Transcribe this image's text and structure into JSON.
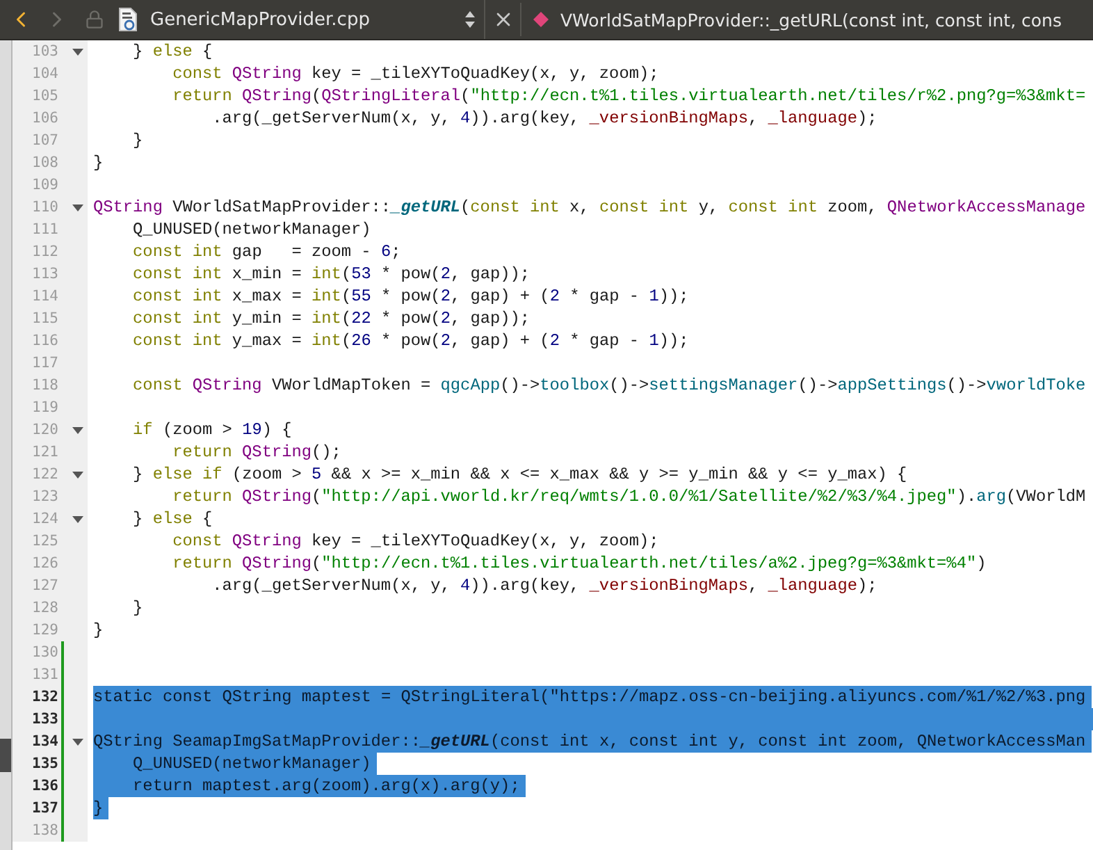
{
  "toolbar": {
    "back": {
      "disabled": false
    },
    "forward": {
      "disabled": true
    },
    "file": "GenericMapProvider.cpp",
    "symbol": "VWorldSatMapProvider::_getURL(const int, const int, cons"
  },
  "lines": [
    {
      "number": "103",
      "fold": true,
      "changed": false,
      "selected": false,
      "tokens": [
        {
          "kind": "plain",
          "text": "    } "
        },
        {
          "kind": "keyword",
          "text": "else"
        },
        {
          "kind": "plain",
          "text": " {"
        }
      ]
    },
    {
      "number": "104",
      "fold": false,
      "changed": false,
      "selected": false,
      "tokens": [
        {
          "kind": "keyword",
          "text": "        const"
        },
        {
          "kind": "type",
          "text": " QString"
        },
        {
          "kind": "plain",
          "text": " key = _tileXYToQuadKey(x, y, zoom);"
        }
      ]
    },
    {
      "number": "105",
      "fold": false,
      "changed": false,
      "selected": false,
      "tokens": [
        {
          "kind": "keyword",
          "text": "        return"
        },
        {
          "kind": "type",
          "text": " QString"
        },
        {
          "kind": "plain",
          "text": "("
        },
        {
          "kind": "type",
          "text": "QStringLiteral"
        },
        {
          "kind": "plain",
          "text": "("
        },
        {
          "kind": "string",
          "text": "\"http://ecn.t%1.tiles.virtualearth.net/tiles/r%2.png?g=%3&mkt="
        }
      ]
    },
    {
      "number": "106",
      "fold": false,
      "changed": false,
      "selected": false,
      "tokens": [
        {
          "kind": "plain",
          "text": "            .arg(_getServerNum(x, y, "
        },
        {
          "kind": "number",
          "text": "4"
        },
        {
          "kind": "plain",
          "text": ")).arg(key, "
        },
        {
          "kind": "member",
          "text": "_versionBingMaps"
        },
        {
          "kind": "plain",
          "text": ", "
        },
        {
          "kind": "member",
          "text": "_language"
        },
        {
          "kind": "plain",
          "text": ");"
        }
      ]
    },
    {
      "number": "107",
      "fold": false,
      "changed": false,
      "selected": false,
      "tokens": [
        {
          "kind": "plain",
          "text": "    }"
        }
      ]
    },
    {
      "number": "108",
      "fold": false,
      "changed": false,
      "selected": false,
      "tokens": [
        {
          "kind": "plain",
          "text": "}"
        }
      ]
    },
    {
      "number": "109",
      "fold": false,
      "changed": false,
      "selected": false
    },
    {
      "number": "110",
      "fold": true,
      "changed": false,
      "selected": false,
      "tokens": [
        {
          "kind": "type",
          "text": "QString"
        },
        {
          "kind": "plain",
          "text": " VWorldSatMapProvider::"
        },
        {
          "kind": "method",
          "text": "_getURL"
        },
        {
          "kind": "plain",
          "text": "("
        },
        {
          "kind": "keyword",
          "text": "const"
        },
        {
          "kind": "keyword",
          "text": " int"
        },
        {
          "kind": "plain",
          "text": " x, "
        },
        {
          "kind": "keyword",
          "text": "const"
        },
        {
          "kind": "keyword",
          "text": " int"
        },
        {
          "kind": "plain",
          "text": " y, "
        },
        {
          "kind": "keyword",
          "text": "const"
        },
        {
          "kind": "keyword",
          "text": " int"
        },
        {
          "kind": "plain",
          "text": " zoom, "
        },
        {
          "kind": "type",
          "text": "QNetworkAccessManage"
        }
      ]
    },
    {
      "number": "111",
      "fold": false,
      "changed": false,
      "selected": false,
      "tokens": [
        {
          "kind": "plain",
          "text": "    Q_UNUSED(networkManager)"
        }
      ]
    },
    {
      "number": "112",
      "fold": false,
      "changed": false,
      "selected": false,
      "tokens": [
        {
          "kind": "keyword",
          "text": "    const"
        },
        {
          "kind": "keyword",
          "text": " int"
        },
        {
          "kind": "plain",
          "text": " gap   = zoom - "
        },
        {
          "kind": "number",
          "text": "6"
        },
        {
          "kind": "plain",
          "text": ";"
        }
      ]
    },
    {
      "number": "113",
      "fold": false,
      "changed": false,
      "selected": false,
      "tokens": [
        {
          "kind": "keyword",
          "text": "    const"
        },
        {
          "kind": "keyword",
          "text": " int"
        },
        {
          "kind": "plain",
          "text": " x_min = "
        },
        {
          "kind": "keyword",
          "text": "int"
        },
        {
          "kind": "plain",
          "text": "("
        },
        {
          "kind": "number",
          "text": "53"
        },
        {
          "kind": "plain",
          "text": " * pow("
        },
        {
          "kind": "number",
          "text": "2"
        },
        {
          "kind": "plain",
          "text": ", gap));"
        }
      ]
    },
    {
      "number": "114",
      "fold": false,
      "changed": false,
      "selected": false,
      "tokens": [
        {
          "kind": "keyword",
          "text": "    const"
        },
        {
          "kind": "keyword",
          "text": " int"
        },
        {
          "kind": "plain",
          "text": " x_max = "
        },
        {
          "kind": "keyword",
          "text": "int"
        },
        {
          "kind": "plain",
          "text": "("
        },
        {
          "kind": "number",
          "text": "55"
        },
        {
          "kind": "plain",
          "text": " * pow("
        },
        {
          "kind": "number",
          "text": "2"
        },
        {
          "kind": "plain",
          "text": ", gap) + ("
        },
        {
          "kind": "number",
          "text": "2"
        },
        {
          "kind": "plain",
          "text": " * gap - "
        },
        {
          "kind": "number",
          "text": "1"
        },
        {
          "kind": "plain",
          "text": "));"
        }
      ]
    },
    {
      "number": "115",
      "fold": false,
      "changed": false,
      "selected": false,
      "tokens": [
        {
          "kind": "keyword",
          "text": "    const"
        },
        {
          "kind": "keyword",
          "text": " int"
        },
        {
          "kind": "plain",
          "text": " y_min = "
        },
        {
          "kind": "keyword",
          "text": "int"
        },
        {
          "kind": "plain",
          "text": "("
        },
        {
          "kind": "number",
          "text": "22"
        },
        {
          "kind": "plain",
          "text": " * pow("
        },
        {
          "kind": "number",
          "text": "2"
        },
        {
          "kind": "plain",
          "text": ", gap));"
        }
      ]
    },
    {
      "number": "116",
      "fold": false,
      "changed": false,
      "selected": false,
      "tokens": [
        {
          "kind": "keyword",
          "text": "    const"
        },
        {
          "kind": "keyword",
          "text": " int"
        },
        {
          "kind": "plain",
          "text": " y_max = "
        },
        {
          "kind": "keyword",
          "text": "int"
        },
        {
          "kind": "plain",
          "text": "("
        },
        {
          "kind": "number",
          "text": "26"
        },
        {
          "kind": "plain",
          "text": " * pow("
        },
        {
          "kind": "number",
          "text": "2"
        },
        {
          "kind": "plain",
          "text": ", gap) + ("
        },
        {
          "kind": "number",
          "text": "2"
        },
        {
          "kind": "plain",
          "text": " * gap - "
        },
        {
          "kind": "number",
          "text": "1"
        },
        {
          "kind": "plain",
          "text": "));"
        }
      ]
    },
    {
      "number": "117",
      "fold": false,
      "changed": false,
      "selected": false
    },
    {
      "number": "118",
      "fold": false,
      "changed": false,
      "selected": false,
      "tokens": [
        {
          "kind": "keyword",
          "text": "    const"
        },
        {
          "kind": "type",
          "text": " QString"
        },
        {
          "kind": "plain",
          "text": " VWorldMapToken = "
        },
        {
          "kind": "call",
          "text": "qgcApp"
        },
        {
          "kind": "plain",
          "text": "()->"
        },
        {
          "kind": "call",
          "text": "toolbox"
        },
        {
          "kind": "plain",
          "text": "()->"
        },
        {
          "kind": "call",
          "text": "settingsManager"
        },
        {
          "kind": "plain",
          "text": "()->"
        },
        {
          "kind": "call",
          "text": "appSettings"
        },
        {
          "kind": "plain",
          "text": "()->"
        },
        {
          "kind": "call",
          "text": "vworldToke"
        }
      ]
    },
    {
      "number": "119",
      "fold": false,
      "changed": false,
      "selected": false
    },
    {
      "number": "120",
      "fold": true,
      "changed": false,
      "selected": false,
      "tokens": [
        {
          "kind": "keyword",
          "text": "    if"
        },
        {
          "kind": "plain",
          "text": " (zoom > "
        },
        {
          "kind": "number",
          "text": "19"
        },
        {
          "kind": "plain",
          "text": ") {"
        }
      ]
    },
    {
      "number": "121",
      "fold": false,
      "changed": false,
      "selected": false,
      "tokens": [
        {
          "kind": "keyword",
          "text": "        return"
        },
        {
          "kind": "type",
          "text": " QString"
        },
        {
          "kind": "plain",
          "text": "();"
        }
      ]
    },
    {
      "number": "122",
      "fold": true,
      "changed": false,
      "selected": false,
      "tokens": [
        {
          "kind": "plain",
          "text": "    } "
        },
        {
          "kind": "keyword",
          "text": "else"
        },
        {
          "kind": "keyword",
          "text": " if"
        },
        {
          "kind": "plain",
          "text": " (zoom > "
        },
        {
          "kind": "number",
          "text": "5"
        },
        {
          "kind": "plain",
          "text": " && x >= x_min && x <= x_max && y >= y_min && y <= y_max) {"
        }
      ]
    },
    {
      "number": "123",
      "fold": false,
      "changed": false,
      "selected": false,
      "tokens": [
        {
          "kind": "keyword",
          "text": "        return"
        },
        {
          "kind": "type",
          "text": " QString"
        },
        {
          "kind": "plain",
          "text": "("
        },
        {
          "kind": "string",
          "text": "\"http://api.vworld.kr/req/wmts/1.0.0/%1/Satellite/%2/%3/%4.jpeg\""
        },
        {
          "kind": "plain",
          "text": ")."
        },
        {
          "kind": "call",
          "text": "arg"
        },
        {
          "kind": "plain",
          "text": "(VWorldM"
        }
      ]
    },
    {
      "number": "124",
      "fold": true,
      "changed": false,
      "selected": false,
      "tokens": [
        {
          "kind": "plain",
          "text": "    } "
        },
        {
          "kind": "keyword",
          "text": "else"
        },
        {
          "kind": "plain",
          "text": " {"
        }
      ]
    },
    {
      "number": "125",
      "fold": false,
      "changed": false,
      "selected": false,
      "tokens": [
        {
          "kind": "keyword",
          "text": "        const"
        },
        {
          "kind": "type",
          "text": " QString"
        },
        {
          "kind": "plain",
          "text": " key = _tileXYToQuadKey(x, y, zoom);"
        }
      ]
    },
    {
      "number": "126",
      "fold": false,
      "changed": false,
      "selected": false,
      "tokens": [
        {
          "kind": "keyword",
          "text": "        return"
        },
        {
          "kind": "type",
          "text": " QString"
        },
        {
          "kind": "plain",
          "text": "("
        },
        {
          "kind": "string",
          "text": "\"http://ecn.t%1.tiles.virtualearth.net/tiles/a%2.jpeg?g=%3&mkt=%4\""
        },
        {
          "kind": "plain",
          "text": ")"
        }
      ]
    },
    {
      "number": "127",
      "fold": false,
      "changed": false,
      "selected": false,
      "tokens": [
        {
          "kind": "plain",
          "text": "            .arg(_getServerNum(x, y, "
        },
        {
          "kind": "number",
          "text": "4"
        },
        {
          "kind": "plain",
          "text": ")).arg(key, "
        },
        {
          "kind": "member",
          "text": "_versionBingMaps"
        },
        {
          "kind": "plain",
          "text": ", "
        },
        {
          "kind": "member",
          "text": "_language"
        },
        {
          "kind": "plain",
          "text": ");"
        }
      ]
    },
    {
      "number": "128",
      "fold": false,
      "changed": false,
      "selected": false,
      "tokens": [
        {
          "kind": "plain",
          "text": "    }"
        }
      ]
    },
    {
      "number": "129",
      "fold": false,
      "changed": false,
      "selected": false,
      "tokens": [
        {
          "kind": "plain",
          "text": "}"
        }
      ]
    },
    {
      "number": "130",
      "fold": false,
      "changed": true,
      "selected": false
    },
    {
      "number": "131",
      "fold": false,
      "changed": true,
      "selected": false
    },
    {
      "number": "132",
      "fold": false,
      "changed": true,
      "selected": true,
      "tokens": [
        {
          "kind": "keyword",
          "text": "static"
        },
        {
          "kind": "keyword",
          "text": " const"
        },
        {
          "kind": "type",
          "text": " QString"
        },
        {
          "kind": "plain",
          "text": " maptest = "
        },
        {
          "kind": "type",
          "text": "QStringLiteral"
        },
        {
          "kind": "plain",
          "text": "("
        },
        {
          "kind": "string",
          "text": "\"https://mapz.oss-cn-beijing.aliyuncs.com/%1/%2/%3.png"
        }
      ]
    },
    {
      "number": "133",
      "fold": false,
      "changed": true,
      "selected": true
    },
    {
      "number": "134",
      "fold": true,
      "changed": true,
      "selected": true,
      "tokens": [
        {
          "kind": "type",
          "text": "QString"
        },
        {
          "kind": "plain",
          "text": " SeamapImgSatMapProvider::"
        },
        {
          "kind": "method",
          "text": "_getURL"
        },
        {
          "kind": "plain",
          "text": "("
        },
        {
          "kind": "keyword",
          "text": "const"
        },
        {
          "kind": "keyword",
          "text": " int"
        },
        {
          "kind": "plain",
          "text": " x, "
        },
        {
          "kind": "keyword",
          "text": "const"
        },
        {
          "kind": "keyword",
          "text": " int"
        },
        {
          "kind": "plain",
          "text": " y, "
        },
        {
          "kind": "keyword",
          "text": "const"
        },
        {
          "kind": "keyword",
          "text": " int"
        },
        {
          "kind": "plain",
          "text": " zoom, "
        },
        {
          "kind": "type",
          "text": "QNetworkAccessMan"
        }
      ]
    },
    {
      "number": "135",
      "fold": false,
      "changed": true,
      "selected": true,
      "tokens": [
        {
          "kind": "plain",
          "text": "    Q_UNUSED(networkManager)"
        }
      ]
    },
    {
      "number": "136",
      "fold": false,
      "changed": true,
      "selected": true,
      "tokens": [
        {
          "kind": "keyword",
          "text": "    return"
        },
        {
          "kind": "plain",
          "text": " maptest.arg(zoom).arg(x).arg(y);"
        }
      ]
    },
    {
      "number": "137",
      "fold": false,
      "changed": true,
      "selected": true,
      "tokens": [
        {
          "kind": "plain",
          "text": "}"
        }
      ]
    },
    {
      "number": "138",
      "fold": false,
      "changed": true,
      "selected": false
    }
  ]
}
